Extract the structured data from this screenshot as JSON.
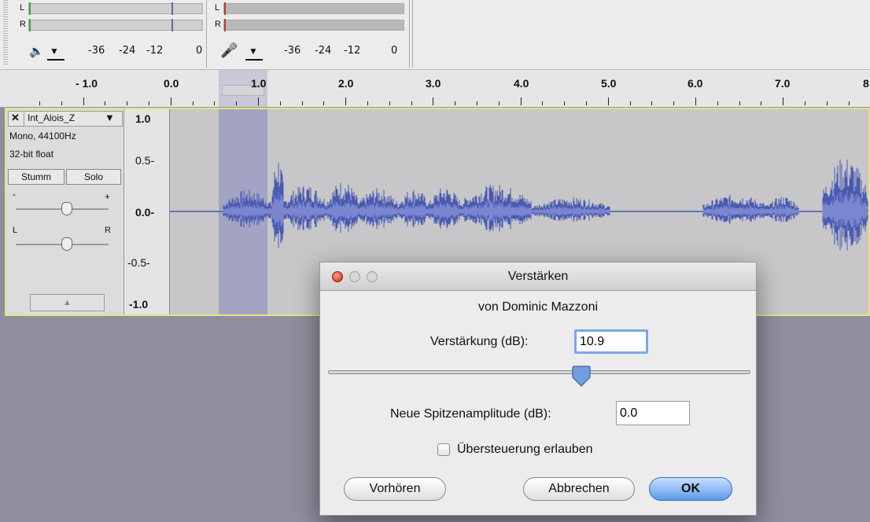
{
  "meters": {
    "play": {
      "left_letter": "L",
      "right_letter": "R",
      "ticks": [
        "-36",
        "-24",
        "-12",
        "0"
      ]
    },
    "record": {
      "left_letter": "L",
      "right_letter": "R",
      "ticks": [
        "-36",
        "-24",
        "-12",
        "0"
      ]
    }
  },
  "icons": {
    "speaker": "speaker-icon",
    "microphone": "microphone-icon",
    "dropdown": "dropdown-arrow-icon"
  },
  "ruler": {
    "labels": [
      "- 1.0",
      "0.0",
      "1.0",
      "2.0",
      "3.0",
      "4.0",
      "5.0",
      "6.0",
      "7.0",
      "8"
    ]
  },
  "track": {
    "name": "Int_Alois_Z",
    "format": "Mono, 44100Hz",
    "bit_depth": "32-bit float",
    "mute_label": "Stumm",
    "solo_label": "Solo",
    "gain_minus": "-",
    "gain_plus": "+",
    "pan_left": "L",
    "pan_right": "R",
    "scale": [
      "1.0",
      "0.5-",
      "0.0-",
      "-0.5-",
      "-1.0"
    ]
  },
  "dialog": {
    "title": "Verstärken",
    "author": "von Dominic Mazzoni",
    "gain_label": "Verstärkung (dB):",
    "gain_value": "10.9",
    "peak_label": "Neue Spitzenamplitude (dB):",
    "peak_value": "0.0",
    "clip_label": "Übersteuerung erlauben",
    "clip_checked": false,
    "preview_label": "Vorhören",
    "cancel_label": "Abbrechen",
    "ok_label": "OK",
    "slider_fraction": 0.6
  },
  "colors": {
    "waveform": "#4a5ab0",
    "waveform_rms": "#7a86cf",
    "selection": "#a3a3c3",
    "track_border": "#e7e37c",
    "ok_button": "#6ea8ee"
  }
}
